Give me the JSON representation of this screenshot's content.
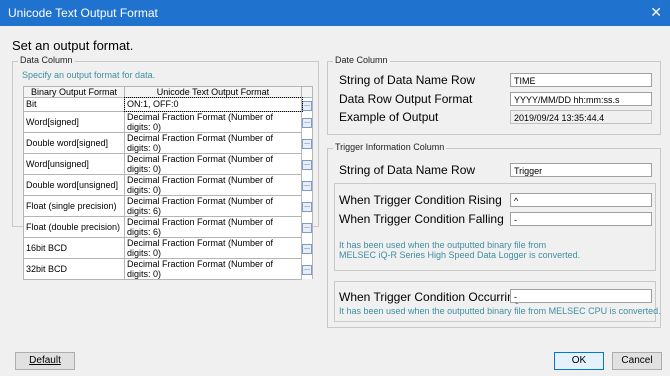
{
  "window": {
    "title": "Unicode Text Output Format"
  },
  "heading": "Set an output format.",
  "data_column": {
    "group_label": "Data Column",
    "hint": "Specify an output format for data.",
    "columns": [
      "Binary Output Format",
      "Unicode Text Output Format"
    ],
    "rows": [
      {
        "binary": "Bit",
        "unicode": "ON:1, OFF:0"
      },
      {
        "binary": "Word[signed]",
        "unicode": "Decimal Fraction Format (Number of digits: 0)"
      },
      {
        "binary": "Double word[signed]",
        "unicode": "Decimal Fraction Format (Number of digits: 0)"
      },
      {
        "binary": "Word[unsigned]",
        "unicode": "Decimal Fraction Format (Number of digits: 0)"
      },
      {
        "binary": "Double word[unsigned]",
        "unicode": "Decimal Fraction Format (Number of digits: 0)"
      },
      {
        "binary": "Float (single precision)",
        "unicode": "Decimal Fraction Format (Number of digits: 6)"
      },
      {
        "binary": "Float (double precision)",
        "unicode": "Decimal Fraction Format (Number of digits: 6)"
      },
      {
        "binary": "16bit BCD",
        "unicode": "Decimal Fraction Format (Number of digits: 0)"
      },
      {
        "binary": "32bit BCD",
        "unicode": "Decimal Fraction Format (Number of digits: 0)"
      }
    ],
    "browse_label": "..."
  },
  "date_column": {
    "group_label": "Date Column",
    "name_row_label": "String of Data Name Row",
    "name_row_value": "TIME",
    "output_format_label": "Data Row Output Format",
    "output_format_value": "YYYY/MM/DD hh:mm:ss.s",
    "example_label": "Example of Output",
    "example_value": "2019/09/24 13:35:44.4"
  },
  "trigger_column": {
    "group_label": "Trigger Information Column",
    "name_row_label": "String of Data Name Row",
    "name_row_value": "Trigger",
    "rising_label": "When Trigger Condition Rising",
    "rising_value": "^",
    "falling_label": "When Trigger Condition Falling",
    "falling_value": "-",
    "rise_fall_note_1": "It has been used when the outputted binary file from",
    "rise_fall_note_2": "MELSEC iQ-R Series High Speed Data Logger is converted.",
    "occurring_label": "When Trigger Condition Occurring",
    "occurring_value": "-",
    "occurring_note": "It has been used when the outputted binary file from MELSEC CPU is converted."
  },
  "footer": {
    "default_label": "Default",
    "ok_label": "OK",
    "cancel_label": "Cancel"
  }
}
